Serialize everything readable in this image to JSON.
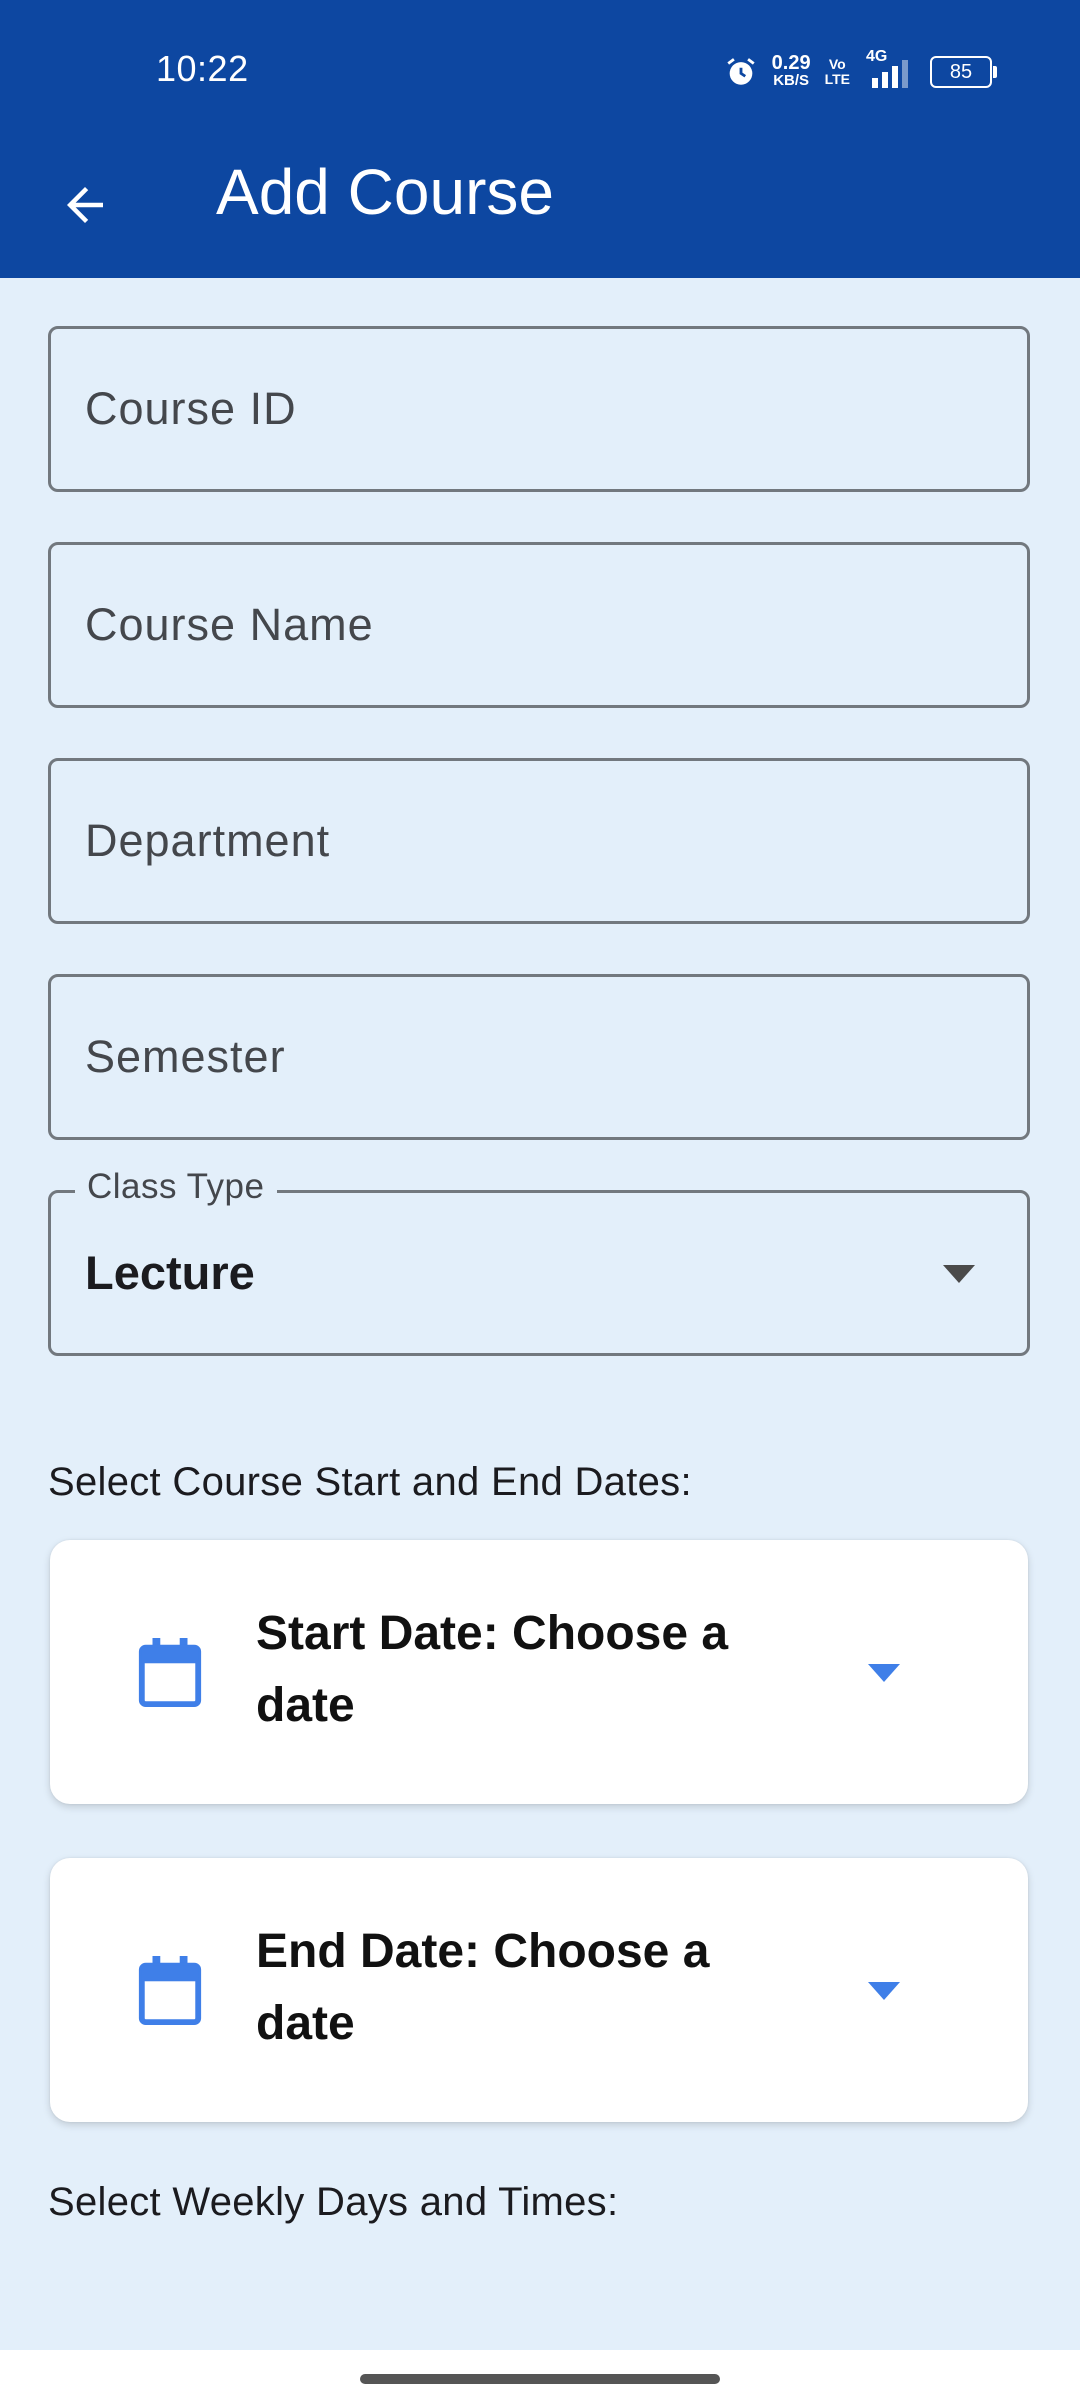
{
  "status_bar": {
    "time": "10:22",
    "net_speed": "0.29",
    "net_unit": "KB/S",
    "volte_top": "Vo",
    "volte_bottom": "LTE",
    "network": "4G",
    "battery": "85"
  },
  "app_bar": {
    "title": "Add Course",
    "back_icon": "arrow-back-icon"
  },
  "form": {
    "course_id": {
      "placeholder": "Course ID",
      "value": ""
    },
    "course_name": {
      "placeholder": "Course Name",
      "value": ""
    },
    "department": {
      "placeholder": "Department",
      "value": ""
    },
    "semester": {
      "placeholder": "Semester",
      "value": ""
    },
    "class_type": {
      "label": "Class Type",
      "value": "Lecture"
    }
  },
  "dates_section": {
    "label": "Select Course Start and End Dates:",
    "start_date": {
      "line1": "Start Date: Choose a",
      "line2": "date",
      "icon": "calendar-icon"
    },
    "end_date": {
      "line1": "End Date: Choose a",
      "line2": "date",
      "icon": "calendar-icon"
    }
  },
  "weekly_section": {
    "label": "Select Weekly Days and Times:"
  },
  "colors": {
    "primary": "#0d47a1",
    "background": "#e3effa",
    "accent": "#3f7fe8"
  }
}
